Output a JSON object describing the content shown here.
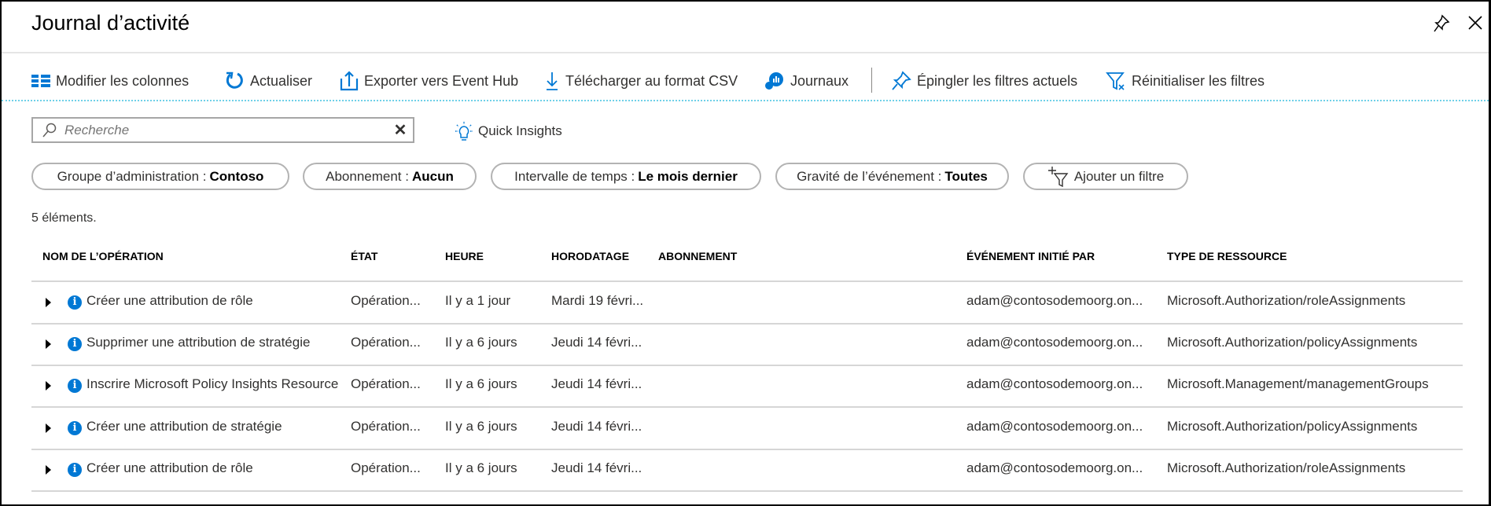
{
  "header": {
    "title": "Journal d’activité"
  },
  "toolbar": {
    "edit_columns": "Modifier les colonnes",
    "refresh": "Actualiser",
    "export": "Exporter vers Event Hub",
    "download": "Télécharger au format CSV",
    "logs": "Journaux",
    "pin_filters": "Épingler les filtres actuels",
    "reset_filters": "Réinitialiser les filtres"
  },
  "search": {
    "placeholder": "Recherche",
    "value": ""
  },
  "quick_insights": "Quick Insights",
  "filters": [
    {
      "label": "Groupe d’administration :",
      "value": "Contoso"
    },
    {
      "label": "Abonnement :",
      "value": "Aucun"
    },
    {
      "label": "Intervalle de temps :",
      "value": "Le mois dernier"
    },
    {
      "label": "Gravité de l’événement :",
      "value": "Toutes"
    }
  ],
  "add_filter": "Ajouter un filtre",
  "count": "5 éléments.",
  "table": {
    "columns": [
      "NOM DE L’OPÉRATION",
      "ÉTAT",
      "HEURE",
      "HORODATAGE",
      "ABONNEMENT",
      "ÉVÉNEMENT INITIÉ PAR",
      "TYPE DE RESSOURCE"
    ],
    "rows": [
      [
        "Créer une attribution de rôle",
        "Opération...",
        "Il y a 1 jour",
        "Mardi 19 févri...",
        "",
        "adam@contosodemoorg.on...",
        "Microsoft.Authorization/roleAssignments"
      ],
      [
        "Supprimer une attribution de stratégie",
        "Opération...",
        "Il y a 6 jours",
        "Jeudi 14 févri...",
        "",
        "adam@contosodemoorg.on...",
        "Microsoft.Authorization/policyAssignments"
      ],
      [
        "Inscrire Microsoft Policy Insights Resource Provider",
        "Opération...",
        "Il y a 6 jours",
        "Jeudi 14 févri...",
        "",
        "adam@contosodemoorg.on...",
        "Microsoft.Management/managementGroups"
      ],
      [
        "Créer une attribution de stratégie",
        "Opération...",
        "Il y a 6 jours",
        "Jeudi 14 févri...",
        "",
        "adam@contosodemoorg.on...",
        "Microsoft.Authorization/policyAssignments"
      ],
      [
        "Créer une attribution de rôle",
        "Opération...",
        "Il y a 6 jours",
        "Jeudi 14 févri...",
        "",
        "adam@contosodemoorg.on...",
        "Microsoft.Authorization/roleAssignments"
      ]
    ]
  },
  "colors": {
    "accent": "#0078d4",
    "divider": "#d6d6d6"
  }
}
